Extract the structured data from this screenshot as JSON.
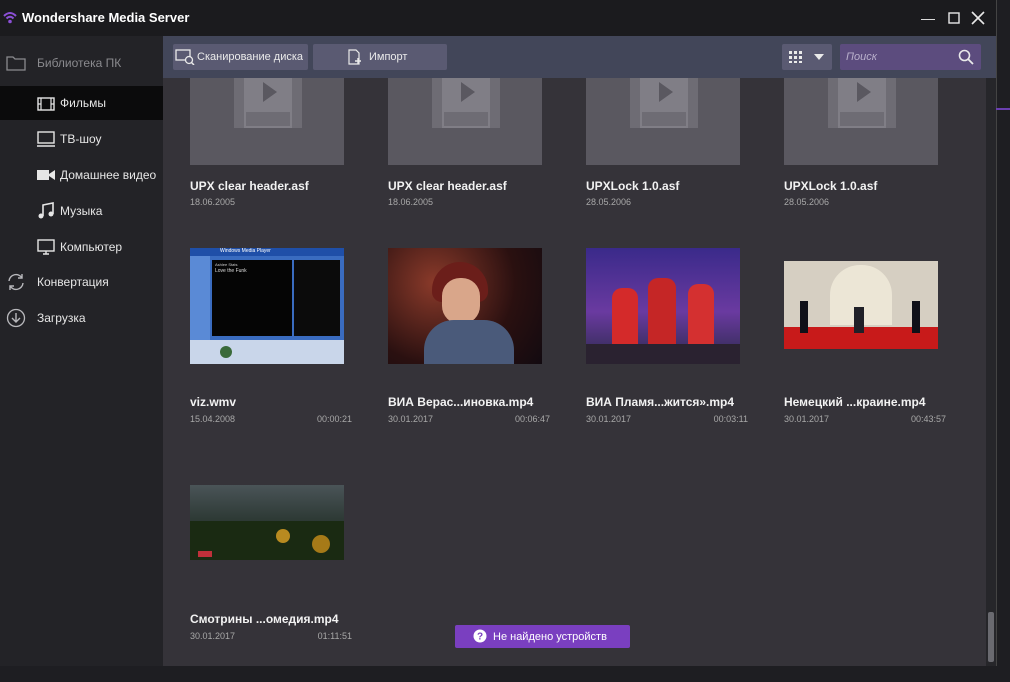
{
  "app": {
    "title": "Wondershare Media Server",
    "accent_color": "#7a3fc0",
    "window_controls": [
      "minimize-icon",
      "maximize-icon",
      "close-icon"
    ]
  },
  "sidebar": {
    "items": [
      {
        "label": "Библиотека ПК",
        "icon": "folder-icon",
        "active": false,
        "level": 0
      },
      {
        "label": "Фильмы",
        "icon": "film-icon",
        "active": true,
        "level": 1
      },
      {
        "label": "ТВ-шоу",
        "icon": "monitor-icon",
        "active": false,
        "level": 1
      },
      {
        "label": "Домашнее видео",
        "icon": "video-camera-icon",
        "active": false,
        "level": 1
      },
      {
        "label": "Музыка",
        "icon": "music-note-icon",
        "active": false,
        "level": 1
      },
      {
        "label": "Компьютер",
        "icon": "computer-icon",
        "active": false,
        "level": 1
      },
      {
        "label": "Конвертация",
        "icon": "convert-icon",
        "active": false,
        "level": 0
      },
      {
        "label": "Загрузка",
        "icon": "download-icon",
        "active": false,
        "level": 0
      }
    ]
  },
  "toolbar": {
    "scan_label": "Сканирование диска",
    "import_label": "Импорт",
    "view_icon": "grid-view-icon",
    "search_placeholder": "Поиск"
  },
  "media": [
    {
      "name": "UPX clear header.asf",
      "date": "18.06.2005",
      "duration": "",
      "thumb": "placeholder"
    },
    {
      "name": "UPX clear header.asf",
      "date": "18.06.2005",
      "duration": "",
      "thumb": "placeholder"
    },
    {
      "name": "UPXLock 1.0.asf",
      "date": "28.05.2006",
      "duration": "",
      "thumb": "placeholder"
    },
    {
      "name": "UPXLock 1.0.asf",
      "date": "28.05.2006",
      "duration": "",
      "thumb": "placeholder"
    },
    {
      "name": "viz.wmv",
      "date": "15.04.2008",
      "duration": "00:00:21",
      "thumb": "media-player",
      "thumb_text": [
        "Windows Media Player",
        "Love the Funk",
        "Ashlee Stats"
      ]
    },
    {
      "name": "ВИА Верас...иновка.mp4",
      "date": "30.01.2017",
      "duration": "00:06:47",
      "thumb": "singer"
    },
    {
      "name": "ВИА Пламя...жится».mp4",
      "date": "30.01.2017",
      "duration": "00:03:11",
      "thumb": "stage"
    },
    {
      "name": "Немецкий ...краине.mp4",
      "date": "30.01.2017",
      "duration": "00:43:57",
      "thumb": "hall"
    },
    {
      "name": "Смотрины ...омедия.mp4",
      "date": "30.01.2017",
      "duration": "01:11:51",
      "thumb": "field"
    }
  ],
  "status": {
    "label": "Не найдено устройств",
    "icon": "question-icon"
  }
}
